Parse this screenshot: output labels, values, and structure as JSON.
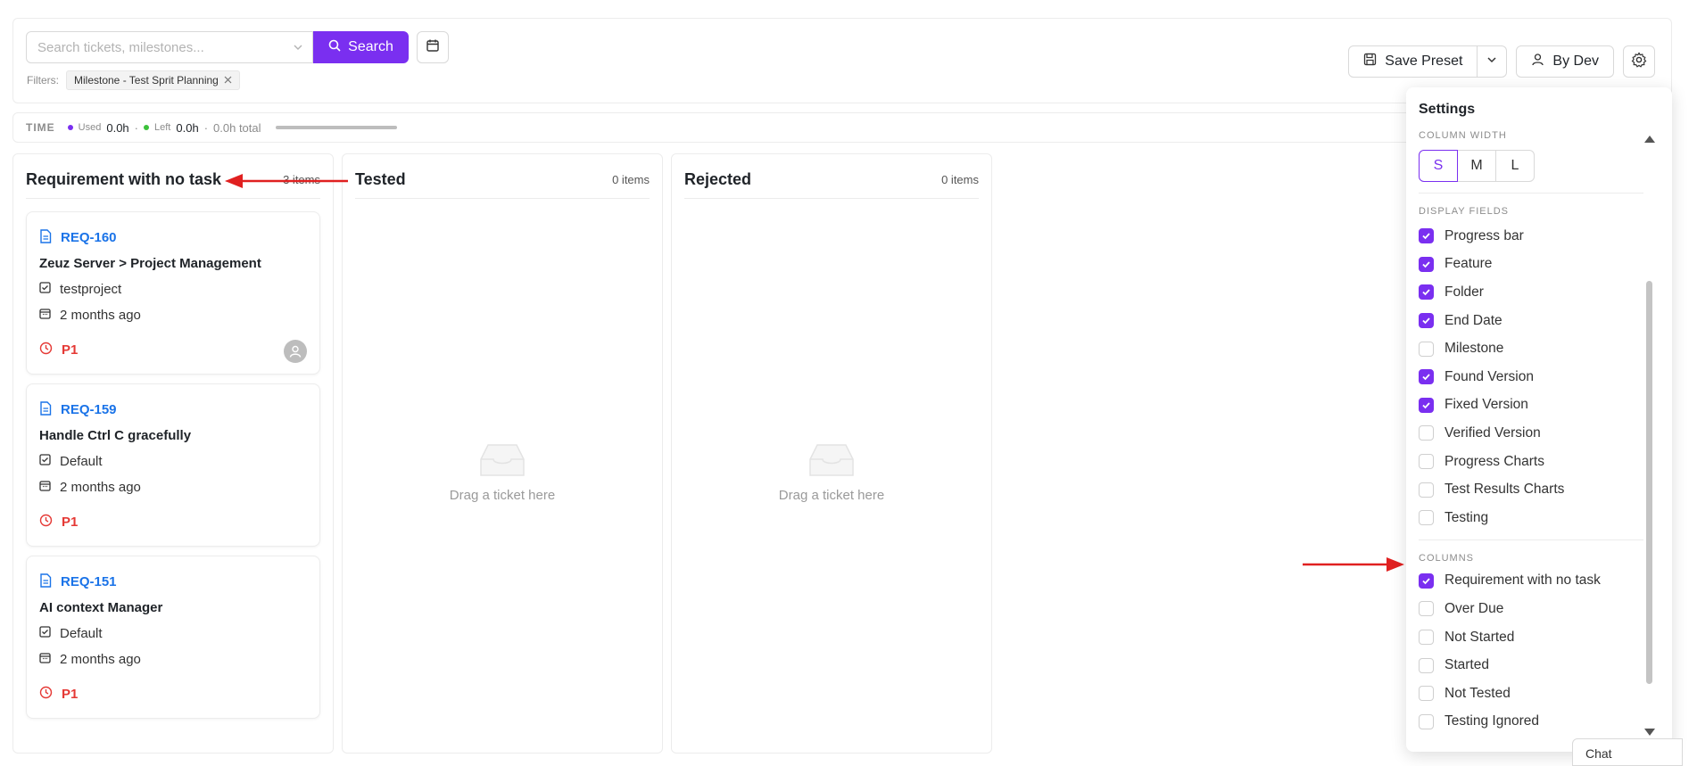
{
  "search": {
    "placeholder": "Search tickets, milestones...",
    "button_label": "Search"
  },
  "filters": {
    "label": "Filters:",
    "tags": [
      "Milestone - Test Sprit Planning"
    ]
  },
  "toolbar": {
    "save_preset_label": "Save Preset",
    "by_dev_label": "By Dev"
  },
  "time": {
    "label": "TIME",
    "used_label": "Used",
    "used_value": "0.0h",
    "left_label": "Left",
    "left_value": "0.0h",
    "total": "0.0h total",
    "used_color": "#7a2ff0",
    "left_color": "#3cc13b"
  },
  "columns": [
    {
      "title": "Requirement with no task",
      "count": "3 items",
      "cards": [
        {
          "id": "REQ-160",
          "title": "Zeuz Server > Project Management",
          "project": "testproject",
          "date": "2 months ago",
          "priority": "P1"
        },
        {
          "id": "REQ-159",
          "title": "Handle Ctrl C gracefully",
          "project": "Default",
          "date": "2 months ago",
          "priority": "P1"
        },
        {
          "id": "REQ-151",
          "title": "AI context Manager",
          "project": "Default",
          "date": "2 months ago",
          "priority": "P1"
        }
      ]
    },
    {
      "title": "Tested",
      "count": "0 items",
      "empty_text": "Drag a ticket here"
    },
    {
      "title": "Rejected",
      "count": "0 items",
      "empty_text": "Drag a ticket here"
    }
  ],
  "settings": {
    "title": "Settings",
    "column_width": {
      "label": "COLUMN WIDTH",
      "options": [
        "S",
        "M",
        "L"
      ],
      "selected": "S"
    },
    "display_fields": {
      "label": "DISPLAY FIELDS",
      "items": [
        {
          "label": "Progress bar",
          "checked": true
        },
        {
          "label": "Feature",
          "checked": true
        },
        {
          "label": "Folder",
          "checked": true
        },
        {
          "label": "End Date",
          "checked": true
        },
        {
          "label": "Milestone",
          "checked": false
        },
        {
          "label": "Found Version",
          "checked": true
        },
        {
          "label": "Fixed Version",
          "checked": true
        },
        {
          "label": "Verified Version",
          "checked": false
        },
        {
          "label": "Progress Charts",
          "checked": false
        },
        {
          "label": "Test Results Charts",
          "checked": false
        },
        {
          "label": "Testing",
          "checked": false
        }
      ]
    },
    "columns": {
      "label": "COLUMNS",
      "items": [
        {
          "label": "Requirement with no task",
          "checked": true
        },
        {
          "label": "Over Due",
          "checked": false
        },
        {
          "label": "Not Started",
          "checked": false
        },
        {
          "label": "Started",
          "checked": false
        },
        {
          "label": "Not Tested",
          "checked": false
        },
        {
          "label": "Testing Ignored",
          "checked": false
        }
      ]
    }
  },
  "chat": {
    "label": "Chat"
  },
  "colors": {
    "accent": "#7a2ff0",
    "link": "#1a73e8",
    "priority": "#e53935",
    "annotation_arrow": "#e02020"
  }
}
